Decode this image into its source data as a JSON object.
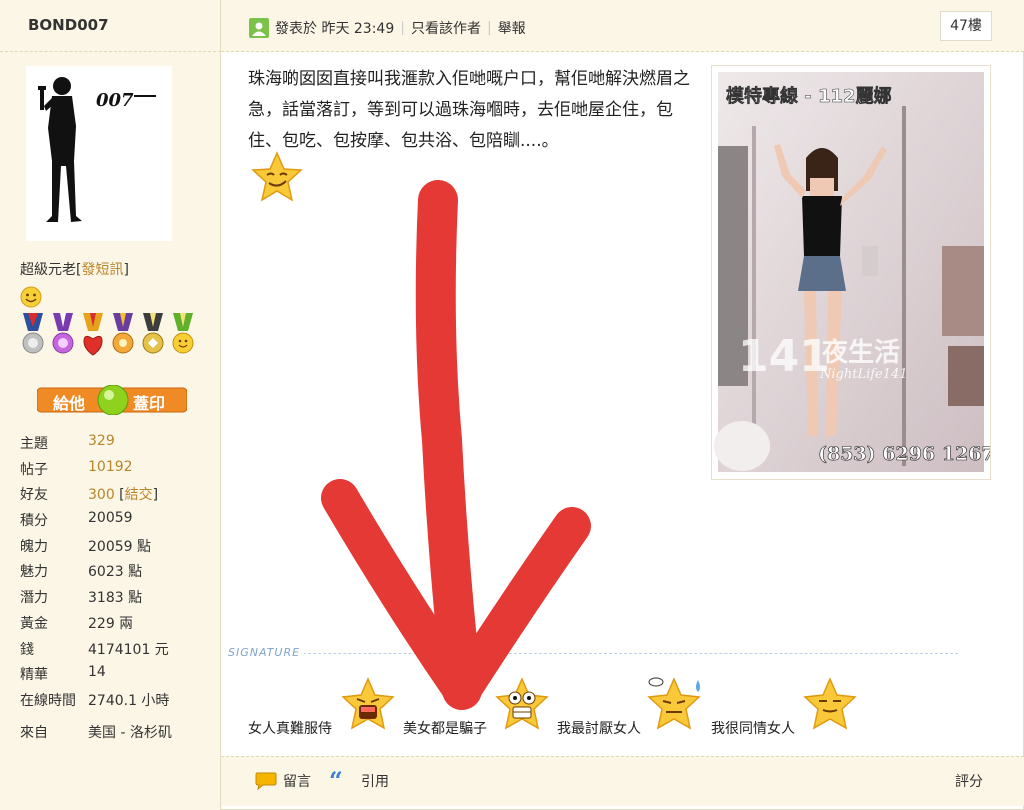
{
  "user": {
    "name": "BOND007",
    "avatar_logo": "007",
    "rank": "超級元老",
    "send_message": "發短訊",
    "stamp_button_left": "給他",
    "stamp_button_right": "蓋印"
  },
  "stats": [
    {
      "label": "主題",
      "value": "329"
    },
    {
      "label": "帖子",
      "value": "10192"
    },
    {
      "label": "好友",
      "value": "300",
      "extra": "結交"
    },
    {
      "label": "積分",
      "value": "20059"
    },
    {
      "label": "魄力",
      "value": "20059 點"
    },
    {
      "label": "魅力",
      "value": "6023 點"
    },
    {
      "label": "潛力",
      "value": "3183 點"
    },
    {
      "label": "黃金",
      "value": "229 兩"
    },
    {
      "label": "錢",
      "value": "4174101 元"
    },
    {
      "label": "精華",
      "value": "14"
    },
    {
      "label": "在線時間",
      "value": "2740.1 小時"
    },
    {
      "label": "來自",
      "value": "美国 - 洛杉矶"
    }
  ],
  "post": {
    "posted_label": "發表於",
    "posted_time": "昨天 23:49",
    "only_author": "只看該作者",
    "report": "舉報",
    "floor": "47樓",
    "text": "珠海啲囡囡直接叫我滙款入佢哋嘅户口，幫佢哋解決燃眉之急，話當落訂，等到可以過珠海嗰時，去佢哋屋企住，包住、包吃、包按摩、包共浴、包陪瞓....。"
  },
  "ad": {
    "title": "模特專線 - 112麗娜",
    "brand_number": "141",
    "brand_text": "夜生活",
    "brand_sub": "NightLife141",
    "phone": "(853) 6296 1267"
  },
  "signature": {
    "label": "SIGNATURE",
    "items": [
      {
        "text": "女人真難服侍"
      },
      {
        "text": "美女都是騙子"
      },
      {
        "text": "我最討厭女人"
      },
      {
        "text": "我很同情女人"
      }
    ]
  },
  "footer": {
    "comment": "留言",
    "quote": "引用",
    "rate": "評分"
  },
  "colors": {
    "sidebar_bg": "#fcf6e6",
    "link": "#b8862b",
    "arrow": "#e53935",
    "stamp_orange": "#f08a24"
  }
}
